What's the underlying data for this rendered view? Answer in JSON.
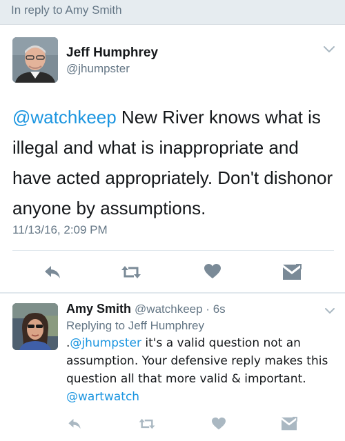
{
  "reply_banner": {
    "text": "In reply to Amy Smith"
  },
  "main_tweet": {
    "name": "Jeff Humphrey",
    "handle": "@jhumpster",
    "mention": "@watchkeep",
    "text": " New River knows what is illegal and what is inappropriate and have acted appropriately.  Don't dishonor anyone by assumptions.",
    "timestamp": "11/13/16, 2:09 PM"
  },
  "reply_tweet": {
    "name": "Amy Smith",
    "handle": "@watchkeep",
    "separator": " · ",
    "time": "6s",
    "replying_to": "Replying to Jeff Humphrey",
    "text_prefix": ".",
    "mention_start": "@jhumpster",
    "text_body": " it's a valid question not an assumption. Your defensive reply makes this question all that more valid & important. ",
    "mention_end": "@wartwatch"
  },
  "icons": {
    "reply": "reply-arrow-icon",
    "retweet": "retweet-icon",
    "like": "heart-icon",
    "dm": "envelope-icon",
    "menu": "chevron-down-icon"
  },
  "colors": {
    "link": "#1b95e0",
    "muted_text": "#657786",
    "icon": "#7a8a97",
    "banner_bg": "#e6ecf0",
    "divider": "#e1e8ed"
  }
}
